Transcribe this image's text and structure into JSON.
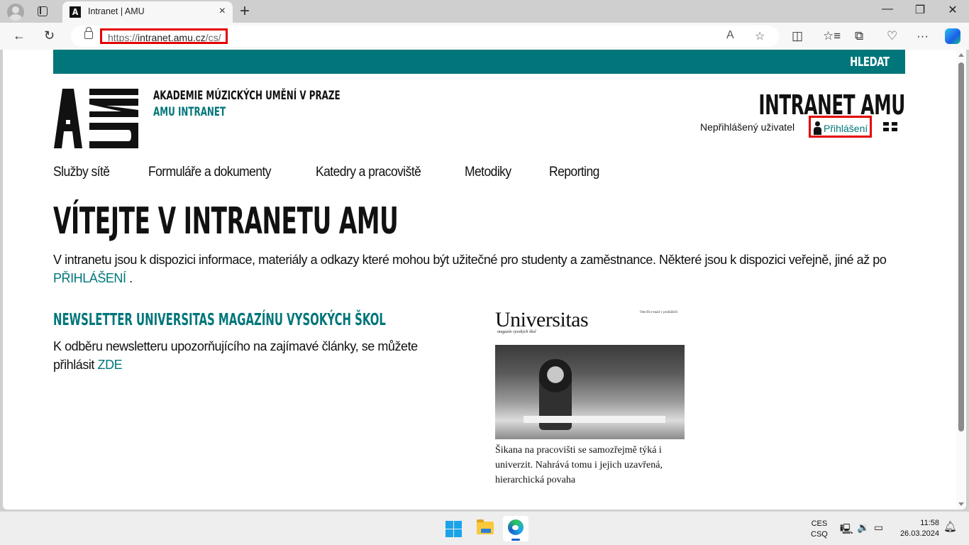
{
  "browser": {
    "tab": {
      "favicon": "A",
      "title": "Intranet | AMU"
    },
    "address_bar": {
      "url_scheme": "https://",
      "url_host": "intranet.amu.cz",
      "url_path": "/cs/"
    },
    "icons": {
      "back": "←",
      "reload": "↻",
      "read_aloud": "A",
      "favorite": "☆",
      "split": "◫",
      "favorites": "☆≡",
      "collections": "⧉",
      "health": "♡",
      "more": "···",
      "minimize": "—",
      "restore": "❐",
      "close": "✕",
      "new_tab": "+",
      "tab_close": "×"
    }
  },
  "page": {
    "topbar": {
      "search_label": "HLEDAT"
    },
    "header": {
      "org_name": "AKADEMIE MÚZICKÝCH UMĚNÍ V PRAZE",
      "org_sub": "AMU INTRANET",
      "site_title": "INTRANET AMU",
      "user_status": "Nepřihlášený uživatel",
      "login_label": "Přihlášení"
    },
    "nav": [
      {
        "label": "Služby sítě"
      },
      {
        "label": "Formuláře a dokumenty"
      },
      {
        "label": "Katedry a pracoviště"
      },
      {
        "label": "Metodiky"
      },
      {
        "label": "Reporting"
      }
    ],
    "heading": "VÍTEJTE V INTRANETU AMU",
    "intro": {
      "text": "V intranetu jsou k dispozici informace, materiály a odkazy které mohou být užitečné pro studenty a zaměstnance. Některé jsou k dispozici veřejně, jiné až po ",
      "link": "PŘIHLÁŠENÍ",
      "suffix": " ."
    },
    "newsletter_section": {
      "heading": "NEWSLETTER UNIVERSITAS MAGAZÍNU VYSOKÝCH ŠKOL",
      "text": "K odběru newsletteru upozorňujícího na zajímavé články, se můžete přihlásit ",
      "link": "ZDE"
    },
    "newsletter_preview": {
      "masthead": "Universitas",
      "tagline": "magazín vysokých škol",
      "check_email": "Otevřít e-mail v prohlížeči",
      "caption": "Šikana na pracovišti se samozřejmě týká i univerzit. Nahrává tomu i jejich uzavřená, hierarchická povaha"
    }
  },
  "taskbar": {
    "lang_top": "CES",
    "lang_bottom": "CSQ",
    "time": "11:58",
    "date": "26.03.2024"
  },
  "colors": {
    "accent": "#00767a",
    "highlight": "#e30000",
    "text": "#111111"
  }
}
